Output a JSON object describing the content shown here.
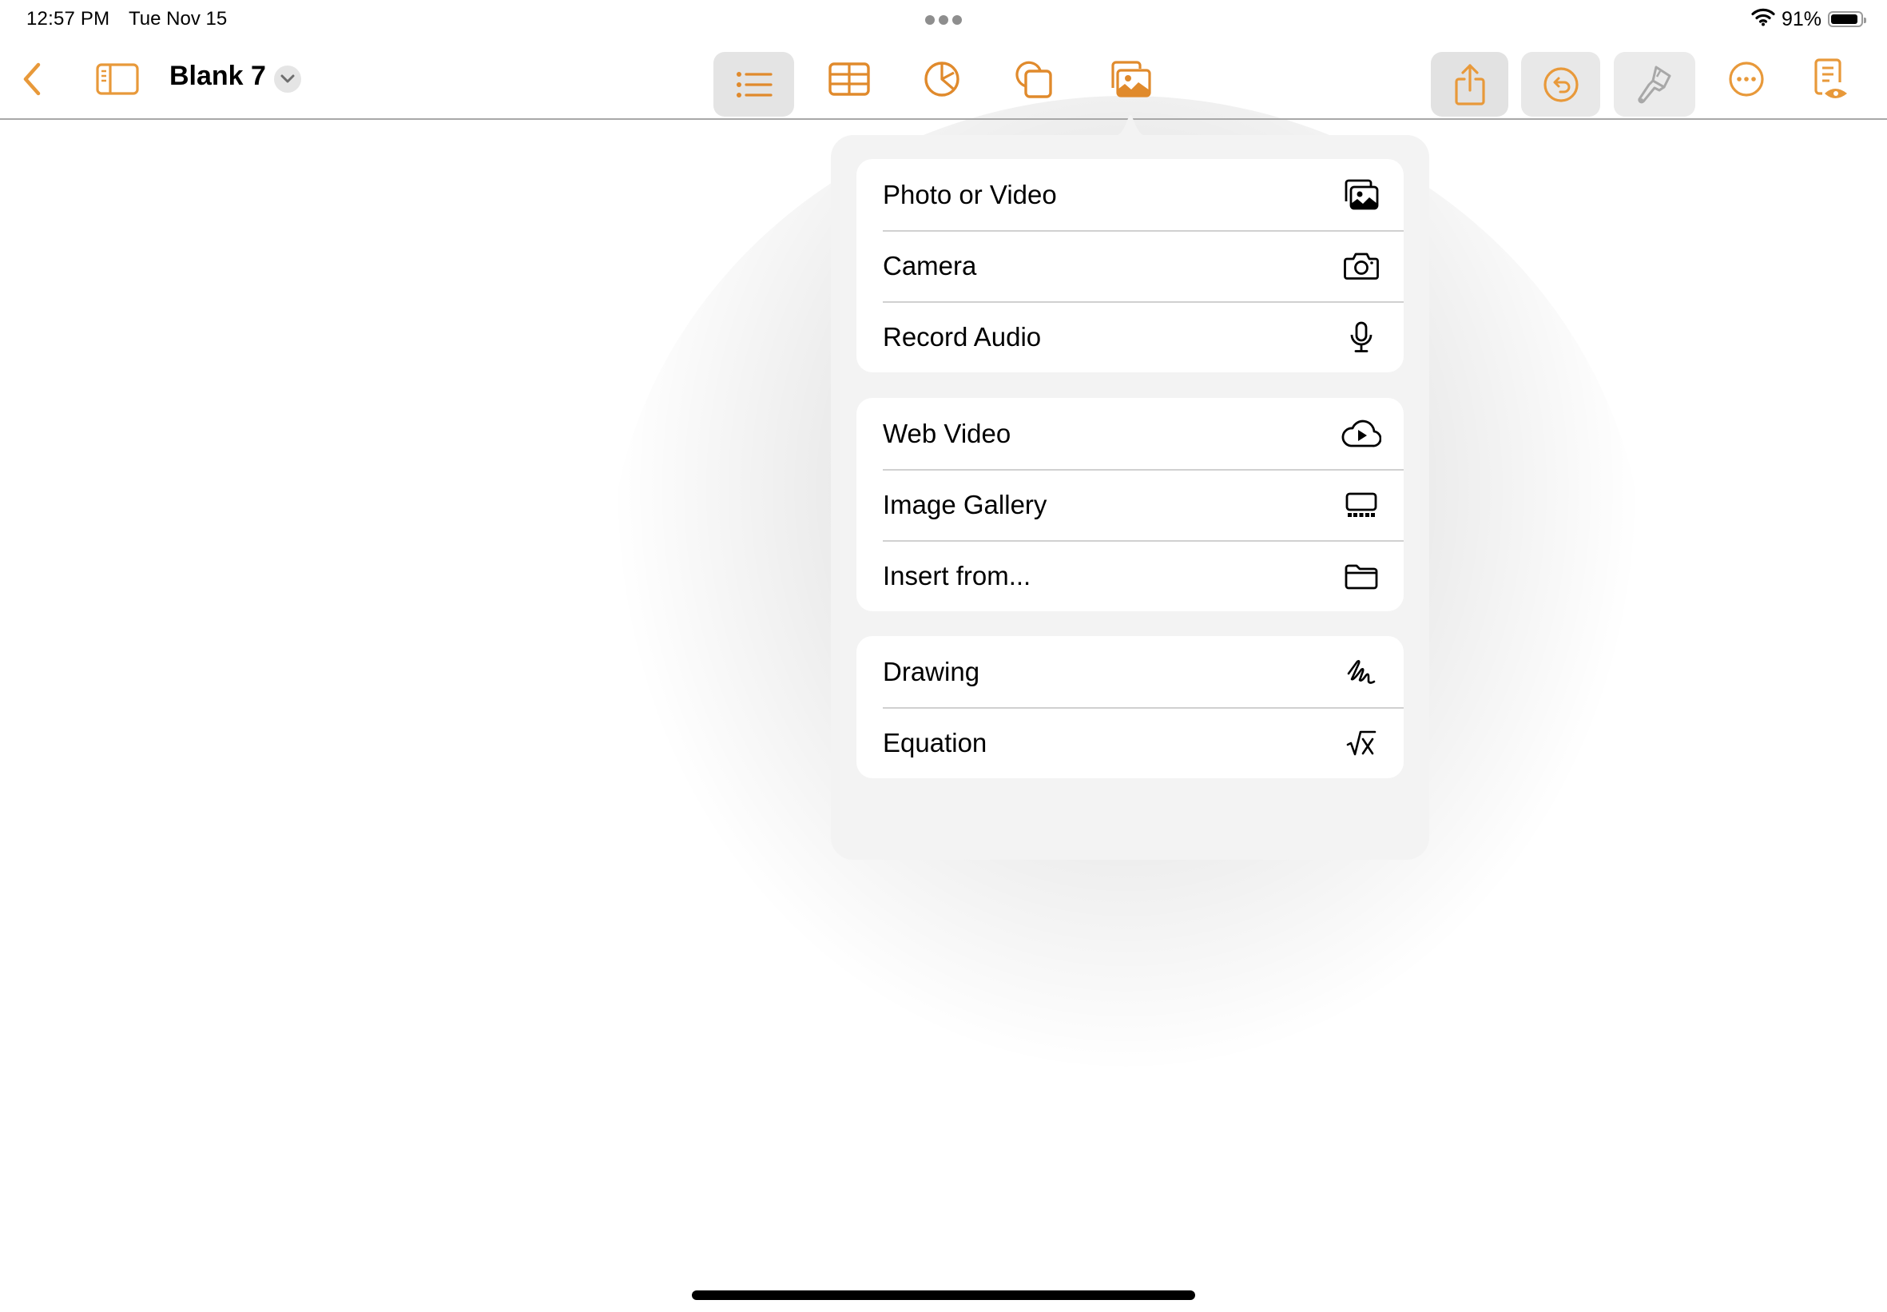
{
  "status_bar": {
    "time": "12:57 PM",
    "date": "Tue Nov 15",
    "battery_percent": "91%",
    "battery_level": 0.91
  },
  "toolbar": {
    "document_title": "Blank 7",
    "left_buttons": [
      {
        "name": "back",
        "icon": "chevron-left-icon"
      },
      {
        "name": "sidebar",
        "icon": "sidebar-icon"
      }
    ],
    "insert_buttons": [
      {
        "name": "text",
        "icon": "list-icon",
        "selected": true
      },
      {
        "name": "table",
        "icon": "table-icon",
        "selected": false
      },
      {
        "name": "chart",
        "icon": "pie-chart-icon",
        "selected": false
      },
      {
        "name": "shape",
        "icon": "shapes-icon",
        "selected": false
      },
      {
        "name": "media",
        "icon": "photo-icon",
        "selected": false,
        "active_popover": true
      }
    ],
    "right_buttons": [
      {
        "name": "share",
        "icon": "share-icon"
      },
      {
        "name": "undo",
        "icon": "undo-icon"
      },
      {
        "name": "format",
        "icon": "paintbrush-icon",
        "disabled": true
      },
      {
        "name": "more",
        "icon": "ellipsis-circle-icon"
      },
      {
        "name": "reading-view",
        "icon": "document-eye-icon"
      }
    ],
    "accent_color": "#E08A2C"
  },
  "media_menu": {
    "groups": [
      {
        "items": [
          {
            "label": "Photo or Video",
            "icon": "photo-stack-icon"
          },
          {
            "label": "Camera",
            "icon": "camera-icon"
          },
          {
            "label": "Record Audio",
            "icon": "microphone-icon"
          }
        ]
      },
      {
        "items": [
          {
            "label": "Web Video",
            "icon": "cloud-play-icon"
          },
          {
            "label": "Image Gallery",
            "icon": "gallery-icon"
          },
          {
            "label": "Insert from...",
            "icon": "folder-icon"
          }
        ]
      },
      {
        "items": [
          {
            "label": "Drawing",
            "icon": "scribble-icon"
          },
          {
            "label": "Equation",
            "icon": "square-root-icon"
          }
        ]
      }
    ]
  }
}
